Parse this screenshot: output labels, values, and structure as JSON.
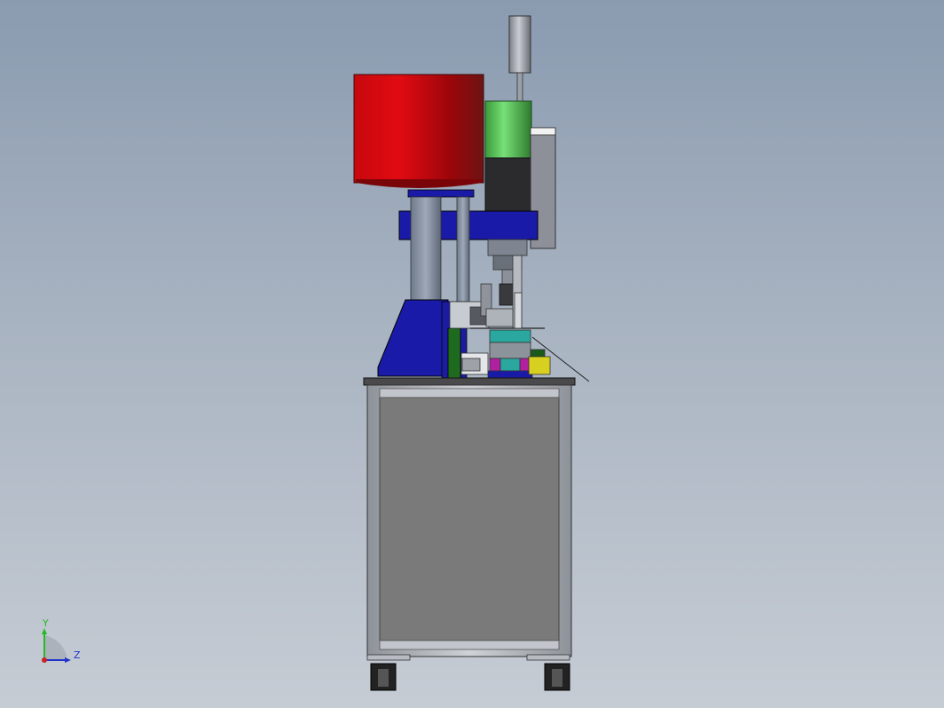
{
  "viewport": {
    "background_top": "#8a9bb0",
    "background_bottom": "#c6ccd4"
  },
  "triad": {
    "y_label": "Y",
    "z_label": "Z",
    "y_color": "#22bb22",
    "z_color": "#2233cc",
    "x_color": "#cc2222"
  },
  "model": {
    "colors": {
      "hopper": "#c8080e",
      "frame_blue": "#1a1aa8",
      "motor_green": "#4cc04c",
      "cabinet_panel": "#7a7a7a",
      "cabinet_frame": "#aeb2b8",
      "tabletop": "#4a4a4c",
      "block_teal": "#2aa8a0",
      "block_magenta": "#b020a0",
      "block_yellow": "#d8d020"
    }
  }
}
